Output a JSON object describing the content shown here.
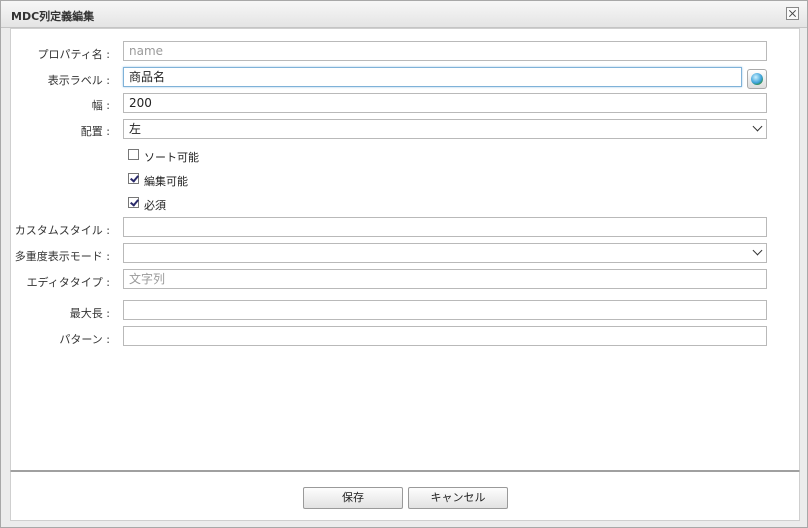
{
  "dialog": {
    "title": "MDC列定義編集"
  },
  "form": {
    "property_name": {
      "label": "プロパティ名 :",
      "placeholder": "name"
    },
    "display_label": {
      "label": "表示ラベル :",
      "value": "商品名"
    },
    "width": {
      "label": "幅 :",
      "value": "200"
    },
    "alignment": {
      "label": "配置 :",
      "value": "左"
    },
    "sortable": {
      "label": "ソート可能",
      "checked": false
    },
    "editable": {
      "label": "編集可能",
      "checked": true
    },
    "required": {
      "label": "必須",
      "checked": true
    },
    "custom_style": {
      "label": "カスタムスタイル :",
      "value": ""
    },
    "multiplicity_mode": {
      "label": "多重度表示モード :",
      "value": ""
    },
    "editor_type": {
      "label": "エディタタイプ :",
      "placeholder": "文字列"
    },
    "max_length": {
      "label": "最大長 :",
      "value": ""
    },
    "pattern": {
      "label": "パターン :",
      "value": ""
    }
  },
  "footer": {
    "save_label": "保存",
    "cancel_label": "キャンセル"
  }
}
